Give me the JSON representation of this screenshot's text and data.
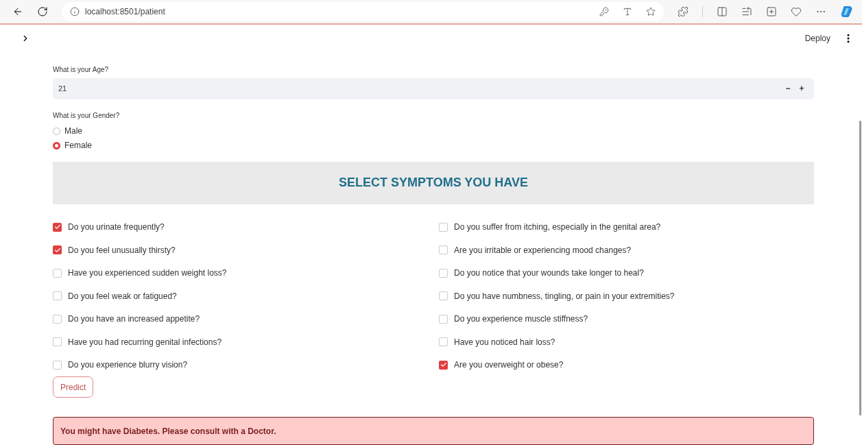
{
  "browser": {
    "url": "localhost:8501/patient"
  },
  "header": {
    "deploy": "Deploy"
  },
  "age": {
    "label": "What is your Age?",
    "value": "21",
    "decrement": "−",
    "increment": "+"
  },
  "gender": {
    "label": "What is your Gender?",
    "options": [
      {
        "label": "Male",
        "selected": false
      },
      {
        "label": "Female",
        "selected": true
      }
    ]
  },
  "symptoms_title": "SELECT SYMPTOMS YOU HAVE",
  "symptoms_left": [
    {
      "label": "Do you urinate frequently?",
      "checked": true
    },
    {
      "label": "Do you feel unusually thirsty?",
      "checked": true
    },
    {
      "label": "Have you experienced sudden weight loss?",
      "checked": false
    },
    {
      "label": "Do you feel weak or fatigued?",
      "checked": false
    },
    {
      "label": "Do you have an increased appetite?",
      "checked": false
    },
    {
      "label": "Have you had recurring genital infections?",
      "checked": false
    },
    {
      "label": "Do you experience blurry vision?",
      "checked": false
    }
  ],
  "symptoms_right": [
    {
      "label": "Do you suffer from itching, especially in the genital area?",
      "checked": false
    },
    {
      "label": "Are you irritable or experiencing mood changes?",
      "checked": false
    },
    {
      "label": "Do you notice that your wounds take longer to heal?",
      "checked": false
    },
    {
      "label": "Do you have numbness, tingling, or pain in your extremities?",
      "checked": false
    },
    {
      "label": "Do you experience muscle stiffness?",
      "checked": false
    },
    {
      "label": "Have you noticed hair loss?",
      "checked": false
    },
    {
      "label": "Are you overweight or obese?",
      "checked": true
    }
  ],
  "predict_button": "Predict",
  "result": "You might have Diabetes. Please consult with a Doctor."
}
